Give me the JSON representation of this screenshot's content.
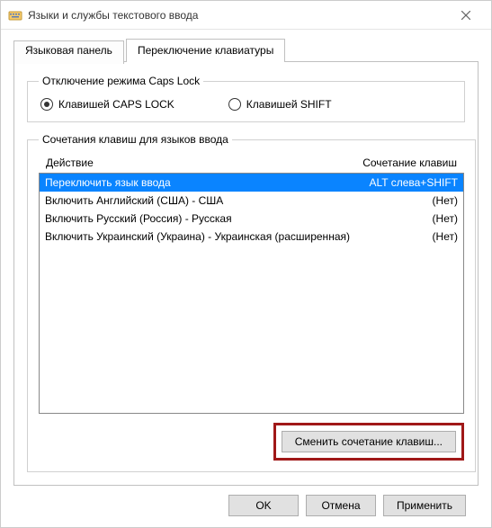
{
  "window": {
    "title": "Языки и службы текстового ввода"
  },
  "tabs": {
    "lang_panel": "Языковая панель",
    "switch_kb": "Переключение клавиатуры"
  },
  "capslock": {
    "legend": "Отключение режима Caps Lock",
    "opt_caps": "Клавишей CAPS LOCK",
    "opt_shift": "Клавишей SHIFT",
    "selected": "caps"
  },
  "shortcuts": {
    "legend": "Сочетания клавиш для языков ввода",
    "header_action": "Действие",
    "header_keys": "Сочетание клавиш",
    "rows": [
      {
        "action": "Переключить язык ввода",
        "keys": "ALT слева+SHIFT",
        "selected": true
      },
      {
        "action": "Включить Английский (США) - США",
        "keys": "(Нет)",
        "selected": false
      },
      {
        "action": "Включить Русский (Россия) - Русская",
        "keys": "(Нет)",
        "selected": false
      },
      {
        "action": "Включить Украинский (Украина) - Украинская (расширенная)",
        "keys": "(Нет)",
        "selected": false
      }
    ],
    "change_btn": "Сменить сочетание клавиш..."
  },
  "footer": {
    "ok": "OK",
    "cancel": "Отмена",
    "apply": "Применить"
  }
}
